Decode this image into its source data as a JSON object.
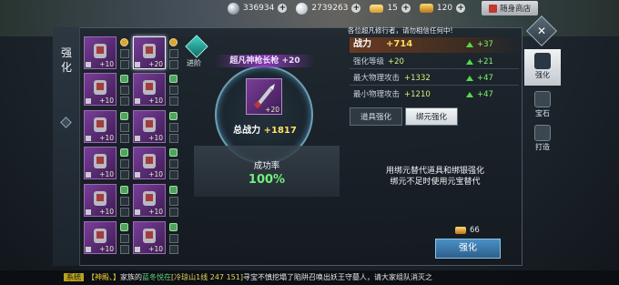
{
  "topbar": {
    "silver": "336934",
    "diamond": "2739263",
    "ingot": "15",
    "gold": "120",
    "shop_label": "随身商店"
  },
  "panel": {
    "side_title": "强化",
    "advance_label": "进阶",
    "notice": "各位超凡修行者，请勿相信任何中!",
    "item_name": "超凡神枪长枪 +20",
    "center_level": "+20",
    "total_power_label": "总战力",
    "total_power_value": "+1817",
    "success_label": "成功率",
    "success_value": "100%"
  },
  "equipment": [
    {
      "level": "+10",
      "name": "armor-chest"
    },
    {
      "level": "+20",
      "name": "spear"
    },
    {
      "level": "+10",
      "name": "shoulder-pads"
    },
    {
      "level": "+10",
      "name": "gauntlets"
    },
    {
      "level": "+10",
      "name": "helmet"
    },
    {
      "level": "+10",
      "name": "belt"
    },
    {
      "level": "+10",
      "name": "leg-guards"
    },
    {
      "level": "+10",
      "name": "cloak"
    },
    {
      "level": "+10",
      "name": "boots"
    },
    {
      "level": "+10",
      "name": "necklace"
    },
    {
      "level": "+10",
      "name": "bracer"
    },
    {
      "level": "+10",
      "name": "ring"
    }
  ],
  "stats": [
    {
      "name": "战力",
      "value": "+714",
      "inc": "+37"
    },
    {
      "name": "强化等级",
      "value": "+20",
      "inc": "+21"
    },
    {
      "name": "最大物理攻击",
      "value": "+1332",
      "inc": "+47"
    },
    {
      "name": "最小物理攻击",
      "value": "+1210",
      "inc": "+47"
    }
  ],
  "tabs": {
    "tab_a": "道具强化",
    "tab_b": "绑元强化"
  },
  "hint": {
    "line1": "用绑元替代道具和绑银强化",
    "line2": "绑元不足时使用元宝替代"
  },
  "cost": "66",
  "enhance_button": "强化",
  "nav": {
    "tab1": "强化",
    "tab2": "宝石",
    "tab3": "打造"
  },
  "chat": {
    "channel": "系统",
    "p1": "【神殿、】",
    "p2": "家族的",
    "p3": "蓝冬悦在",
    "p4": "[冷琼山1线 247 151]",
    "p5": "寻宝不慎挖塌了陷阱召唤出妖王守墓人，请大家组队消灭之"
  },
  "colors": {
    "accent_power": "#ffd85a",
    "increase_green": "#8aef72",
    "item_purple": "#7a3e98",
    "button_blue": "#4a90c6"
  }
}
